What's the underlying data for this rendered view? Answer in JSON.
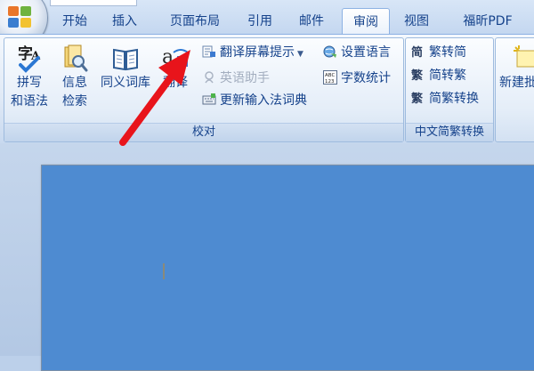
{
  "tabs": [
    {
      "label": "开始",
      "active": false
    },
    {
      "label": "插入",
      "active": false
    },
    {
      "label": "页面布局",
      "active": false
    },
    {
      "label": "引用",
      "active": false
    },
    {
      "label": "邮件",
      "active": false
    },
    {
      "label": "审阅",
      "active": true
    },
    {
      "label": "视图",
      "active": false
    },
    {
      "label": "福昕PDF",
      "active": false
    }
  ],
  "proofing": {
    "group_label": "校对",
    "spelling": {
      "line1": "拼写",
      "line2": "和语法",
      "icon": "spelling-icon"
    },
    "research": {
      "line1": "信息",
      "line2": "检索",
      "icon": "research-icon"
    },
    "thesaurus": {
      "label": "同义词库",
      "icon": "book-icon"
    },
    "translate": {
      "label": "翻译",
      "icon": "translate-icon"
    },
    "translation_tip": {
      "label": "翻译屏幕提示",
      "icon": "translation-tip-icon"
    },
    "english_assistant": {
      "label": "英语助手",
      "icon": "english-assistant-icon",
      "enabled": false
    },
    "update_ime": {
      "label": "更新输入法词典",
      "icon": "ime-dictionary-icon"
    },
    "set_language": {
      "label": "设置语言",
      "icon": "language-icon"
    },
    "word_count": {
      "label": "字数统计",
      "icon": "word-count-icon",
      "icon_text": "ABC 123"
    }
  },
  "chinese_conversion": {
    "group_label": "中文简繁转换",
    "to_simplified": {
      "label": "繁转简",
      "icon": "traditional-to-simplified-icon"
    },
    "to_traditional": {
      "label": "简转繁",
      "icon": "simplified-to-traditional-icon"
    },
    "convert": {
      "label": "简繁转换",
      "icon": "conversion-icon"
    }
  },
  "comments": {
    "new_comment": {
      "label": "新建批",
      "icon": "new-comment-icon"
    }
  },
  "colors": {
    "accent_text": "#15428b",
    "page_fill": "#4e8bd1",
    "arrow": "#e8141b"
  }
}
